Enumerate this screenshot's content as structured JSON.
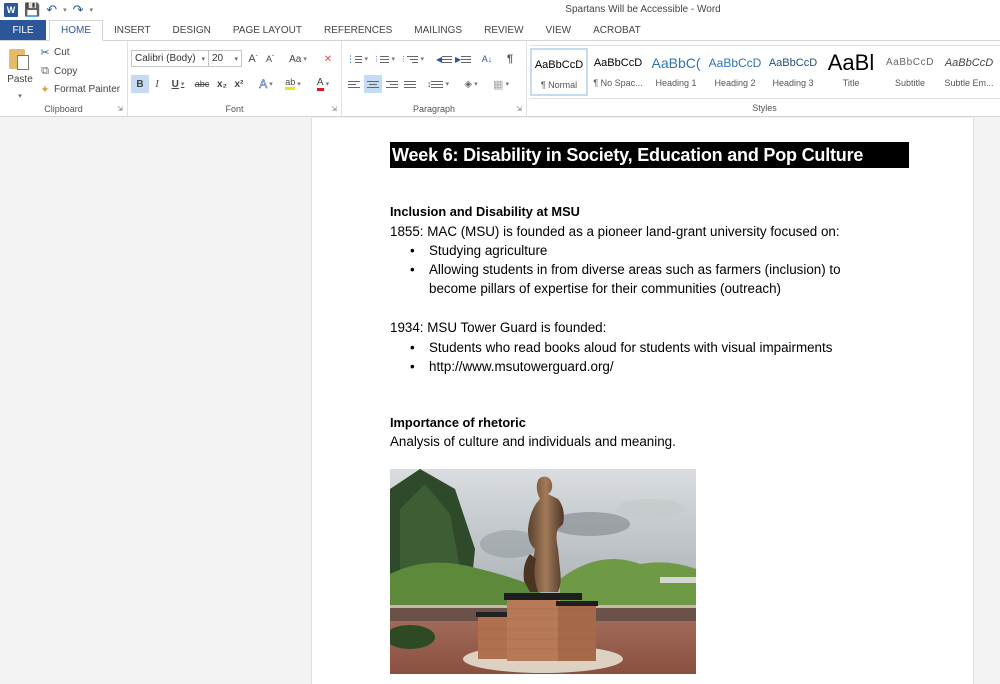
{
  "window": {
    "title": "Spartans Will be Accessible - Word"
  },
  "qat": {
    "save_icon": "save-icon",
    "undo_icon": "undo-icon",
    "redo_icon": "redo-icon",
    "customize_icon": "customize-icon"
  },
  "tabs": [
    {
      "label": "FILE"
    },
    {
      "label": "HOME"
    },
    {
      "label": "INSERT"
    },
    {
      "label": "DESIGN"
    },
    {
      "label": "PAGE LAYOUT"
    },
    {
      "label": "REFERENCES"
    },
    {
      "label": "MAILINGS"
    },
    {
      "label": "REVIEW"
    },
    {
      "label": "VIEW"
    },
    {
      "label": "ACROBAT"
    }
  ],
  "ribbon": {
    "clipboard": {
      "label": "Clipboard",
      "paste": "Paste",
      "cut": "Cut",
      "copy": "Copy",
      "format_painter": "Format Painter"
    },
    "font": {
      "label": "Font",
      "font_name": "Calibri (Body)",
      "font_size": "20",
      "grow": "A",
      "shrink": "A",
      "change_case": "Aa",
      "bold": "B",
      "italic": "I",
      "underline": "U",
      "strikethrough": "abc",
      "subscript": "x₂",
      "superscript": "x²",
      "text_effects": "A",
      "highlight": "ab",
      "font_color": "A",
      "highlight_color": "#f5e400",
      "font_color_value": "#e81123"
    },
    "paragraph": {
      "label": "Paragraph",
      "sort": "A↓",
      "show_marks": "¶"
    },
    "styles": {
      "label": "Styles",
      "items": [
        {
          "sample": "AaBbCcD",
          "name": "¶ Normal",
          "selected": true
        },
        {
          "sample": "AaBbCcD",
          "name": "¶ No Spac..."
        },
        {
          "sample": "AaBbC(",
          "name": "Heading 1"
        },
        {
          "sample": "AaBbCcD",
          "name": "Heading 2"
        },
        {
          "sample": "AaBbCcD",
          "name": "Heading 3"
        },
        {
          "sample": "AaBl",
          "name": "Title"
        },
        {
          "sample": "AaBbCcD",
          "name": "Subtitle"
        },
        {
          "sample": "AaBbCcD",
          "name": "Subtle Em..."
        }
      ]
    }
  },
  "document": {
    "title": "Week 6: Disability in Society, Education and Pop Culture",
    "section1_heading": "Inclusion and Disability at MSU",
    "line_1855": "1855: MAC (MSU) is founded as a pioneer land-grant university focused on:",
    "bullets_1855": [
      "Studying agriculture",
      "Allowing students in from diverse areas such as farmers (inclusion) to",
      "become pillars of expertise for their communities (outreach)"
    ],
    "line_1934": "1934: MSU Tower Guard is founded:",
    "bullets_1934": [
      "Students who read books aloud for students with visual impairments",
      "http://www.msutowerguard.org/"
    ],
    "section2_heading": "Importance of rhetoric",
    "section2_text": "Analysis of culture and individuals and meaning.",
    "bullet_glyph": "•",
    "image_subject": "Spartan statue on brick pedestal"
  }
}
